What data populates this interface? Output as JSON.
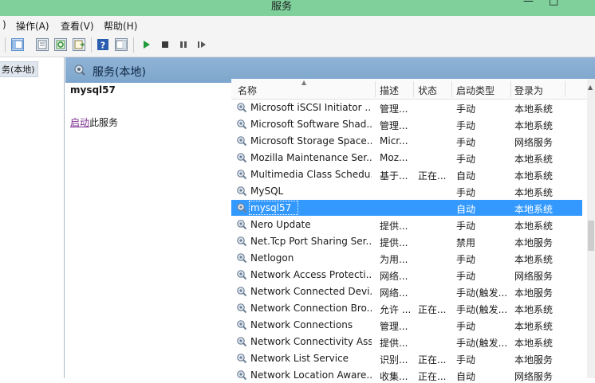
{
  "window": {
    "title": "服务",
    "min_icon": "minimize-icon",
    "max_icon": "maximize-icon"
  },
  "menu": {
    "action": "操作(A)",
    "view": "查看(V)",
    "help": "帮助(H)"
  },
  "tree": {
    "selected": "务(本地)"
  },
  "panel": {
    "header": "服务(本地)",
    "selected_service": "mysql57",
    "link_text": "启动",
    "link_suffix": "此服务"
  },
  "columns": {
    "name": "名称",
    "desc": "描述",
    "status": "状态",
    "startup": "启动类型",
    "logon": "登录为"
  },
  "rows": [
    {
      "name": "Microsoft iSCSI Initiator ...",
      "desc": "管理...",
      "status": "",
      "startup": "手动",
      "logon": "本地系统"
    },
    {
      "name": "Microsoft Software Shad...",
      "desc": "管理...",
      "status": "",
      "startup": "手动",
      "logon": "本地系统"
    },
    {
      "name": "Microsoft Storage Space...",
      "desc": "Micr...",
      "status": "",
      "startup": "手动",
      "logon": "网络服务"
    },
    {
      "name": "Mozilla Maintenance Ser...",
      "desc": "Moz...",
      "status": "",
      "startup": "手动",
      "logon": "本地系统"
    },
    {
      "name": "Multimedia Class Schedu...",
      "desc": "基于...",
      "status": "正在...",
      "startup": "自动",
      "logon": "本地系统"
    },
    {
      "name": "MySQL",
      "desc": "",
      "status": "",
      "startup": "手动",
      "logon": "本地系统"
    },
    {
      "name": "mysql57",
      "desc": "",
      "status": "",
      "startup": "自动",
      "logon": "本地系统"
    },
    {
      "name": "Nero Update",
      "desc": "提供...",
      "status": "",
      "startup": "手动",
      "logon": "本地系统"
    },
    {
      "name": "Net.Tcp Port Sharing Ser...",
      "desc": "提供...",
      "status": "",
      "startup": "禁用",
      "logon": "本地服务"
    },
    {
      "name": "Netlogon",
      "desc": "为用...",
      "status": "",
      "startup": "手动",
      "logon": "本地系统"
    },
    {
      "name": "Network Access Protecti...",
      "desc": "网络...",
      "status": "",
      "startup": "手动",
      "logon": "网络服务"
    },
    {
      "name": "Network Connected Devi...",
      "desc": "网络...",
      "status": "",
      "startup": "手动(触发...",
      "logon": "本地服务"
    },
    {
      "name": "Network Connection Bro...",
      "desc": "允许 ...",
      "status": "正在...",
      "startup": "手动(触发...",
      "logon": "本地系统"
    },
    {
      "name": "Network Connections",
      "desc": "管理...",
      "status": "",
      "startup": "手动",
      "logon": "本地系统"
    },
    {
      "name": "Network Connectivity Ass...",
      "desc": "提供...",
      "status": "",
      "startup": "手动(触发...",
      "logon": "本地系统"
    },
    {
      "name": "Network List Service",
      "desc": "识别...",
      "status": "正在...",
      "startup": "手动",
      "logon": "本地服务"
    },
    {
      "name": "Network Location Aware...",
      "desc": "收集...",
      "status": "正在...",
      "startup": "自动",
      "logon": "网络服务"
    }
  ],
  "selected_row": 6,
  "colors": {
    "titlebar": "#7fd09b",
    "panel_header": "#8fb3d6",
    "selection": "#3399ff",
    "link": "#7b2d8e"
  }
}
